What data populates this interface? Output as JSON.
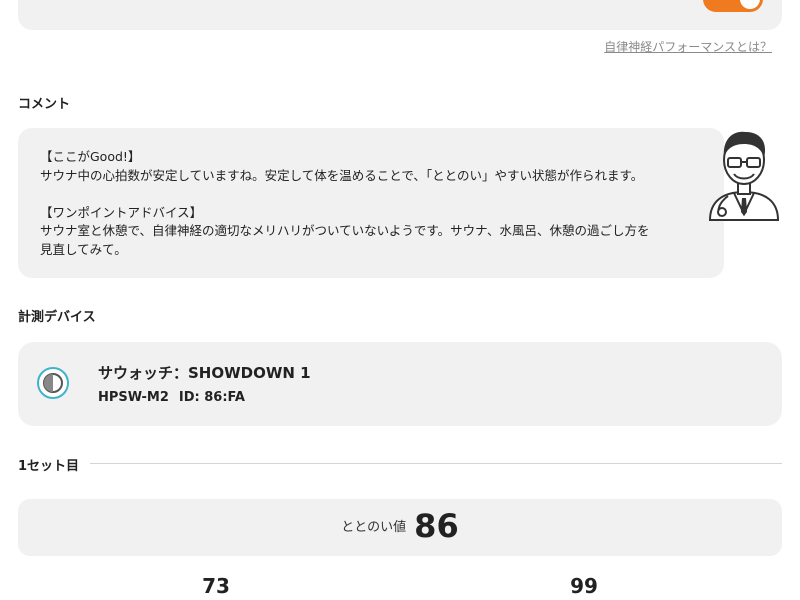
{
  "top_section": {
    "toggle_state": "on",
    "help_link": "自律神経パフォーマンスとは？",
    "accent_color": "#f07a1f"
  },
  "comment": {
    "title": "コメント",
    "good_heading": "【ここがGood!】",
    "good_text": "サウナ中の心拍数が安定していますね。安定して体を温めることで、「ととのい」やすい状態が作られます。",
    "advice_heading": "【ワンポイントアドバイス】",
    "advice_line1": "サウナ室と休憩で、自律神経の適切なメリハリがついていないようです。サウナ、水風呂、休憩の過ごし方を",
    "advice_line2": "見直してみて。",
    "avatar_icon": "doctor-avatar-icon"
  },
  "device": {
    "title": "計測デバイス",
    "name": "サウォッチ：SHOWDOWN 1",
    "model": "HPSW-M2",
    "id": "ID: 86:FA",
    "icon": "watch-device-icon"
  },
  "set": {
    "label": "1セット目",
    "score_label": "ととのい値",
    "score_value": "86",
    "stat_left": "73",
    "stat_right": "99"
  }
}
